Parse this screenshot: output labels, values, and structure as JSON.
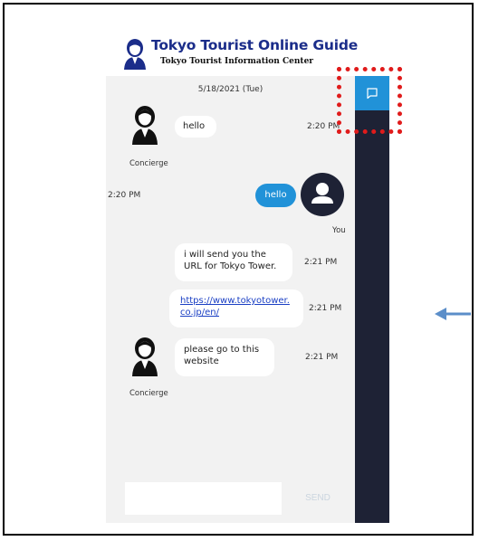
{
  "header": {
    "title": "Tokyo Tourist Online Guide",
    "subtitle": "Tokyo Tourist Information Center"
  },
  "chat": {
    "date": "5/18/2021 (Tue)",
    "messages": [
      {
        "sender": "Concierge",
        "text": "hello",
        "time": "2:20 PM"
      },
      {
        "sender": "You",
        "text": "hello",
        "time": "2:20 PM"
      },
      {
        "sender": "Concierge",
        "text": "i will send you the URL for Tokyo Tower.",
        "time": "2:21 PM"
      },
      {
        "sender": "Concierge",
        "link": "https://www.tokyotower.co.jp/en/",
        "link_line1": "https://www.tokyotower.",
        "link_line2": "co.jp/en/",
        "time": "2:21 PM"
      },
      {
        "sender": "Concierge",
        "text": "please go to this website",
        "time": "2:21 PM"
      }
    ]
  },
  "labels": {
    "concierge": "Concierge",
    "you": "You"
  },
  "composer": {
    "placeholder": "",
    "send_label": "SEND"
  },
  "sidebar": {
    "icon": "chat-icon"
  },
  "colors": {
    "accent": "#2192d8",
    "sidebar": "#1e2235",
    "title": "#1b2d8a",
    "highlight": "#e01b1b",
    "arrow": "#5b8ec9"
  }
}
